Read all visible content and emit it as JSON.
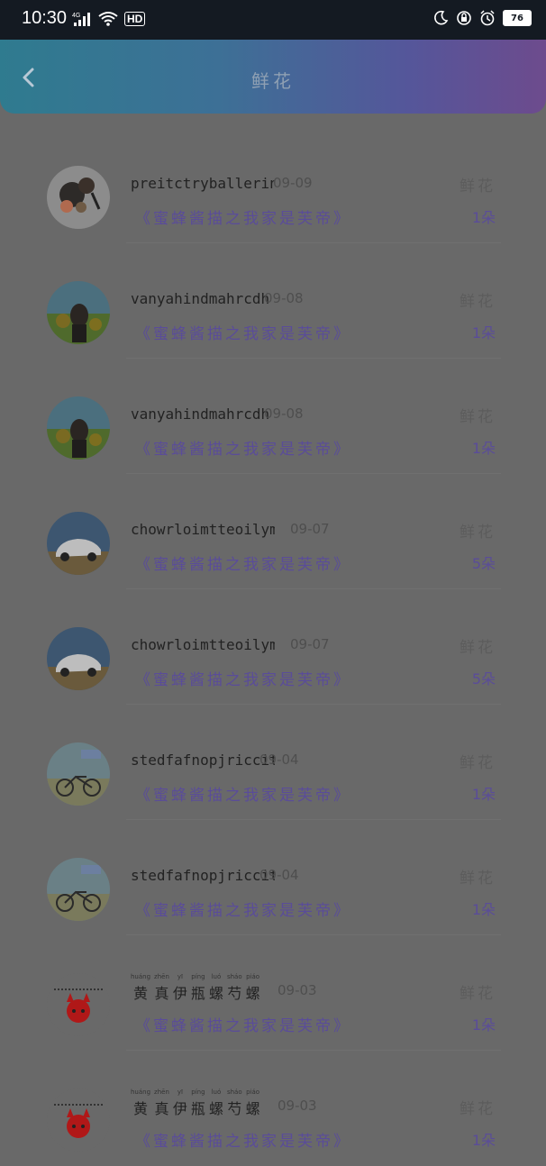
{
  "status_bar": {
    "time": "10:30",
    "network": "4G",
    "hd": "HD",
    "battery": "76"
  },
  "header": {
    "title": "鲜花",
    "back_icon": "chevron-left-icon"
  },
  "rows": [
    {
      "name": "preitctryballerinas",
      "date": "09-09",
      "label": "鲜花",
      "song": "《蜜蜂酱描之我家是芙帝》",
      "count": "1朵",
      "avatar": "cups"
    },
    {
      "name": "vanyahindmahrcdh",
      "date": "09-08",
      "label": "鲜花",
      "song": "《蜜蜂酱描之我家是芙帝》",
      "count": "1朵",
      "avatar": "girl-field"
    },
    {
      "name": "vanyahindmahrcdh",
      "date": "09-08",
      "label": "鲜花",
      "song": "《蜜蜂酱描之我家是芙帝》",
      "count": "1朵",
      "avatar": "girl-field"
    },
    {
      "name": "chowrloimtteoilym…",
      "date": "09-07",
      "label": "鲜花",
      "song": "《蜜蜂酱描之我家是芙帝》",
      "count": "5朵",
      "avatar": "car"
    },
    {
      "name": "chowrloimtteoilym…",
      "date": "09-07",
      "label": "鲜花",
      "song": "《蜜蜂酱描之我家是芙帝》",
      "count": "5朵",
      "avatar": "car"
    },
    {
      "name": "stedfafnopjriccit",
      "date": "09-04",
      "label": "鲜花",
      "song": "《蜜蜂酱描之我家是芙帝》",
      "count": "1朵",
      "avatar": "bike"
    },
    {
      "name": "stedfafnopjriccit",
      "date": "09-04",
      "label": "鲜花",
      "song": "《蜜蜂酱描之我家是芙帝》",
      "count": "1朵",
      "avatar": "bike"
    },
    {
      "name_chars": [
        "黄",
        "真",
        "伊",
        "瓶",
        "螺",
        "芍",
        "螺"
      ],
      "name_pinyin": [
        "huáng",
        "zhēn",
        "yī",
        "píng",
        "luó",
        "sháo",
        "piáo"
      ],
      "date": "09-03",
      "label": "鲜花",
      "song": "《蜜蜂酱描之我家是芙帝》",
      "count": "1朵",
      "avatar": "cartoon-fox"
    },
    {
      "name_chars": [
        "黄",
        "真",
        "伊",
        "瓶",
        "螺",
        "芍",
        "螺"
      ],
      "name_pinyin": [
        "huáng",
        "zhēn",
        "yī",
        "píng",
        "luó",
        "sháo",
        "piáo"
      ],
      "date": "09-03",
      "label": "鲜花",
      "song": "《蜜蜂酱描之我家是芙帝》",
      "count": "1朵",
      "avatar": "cartoon-fox"
    }
  ]
}
